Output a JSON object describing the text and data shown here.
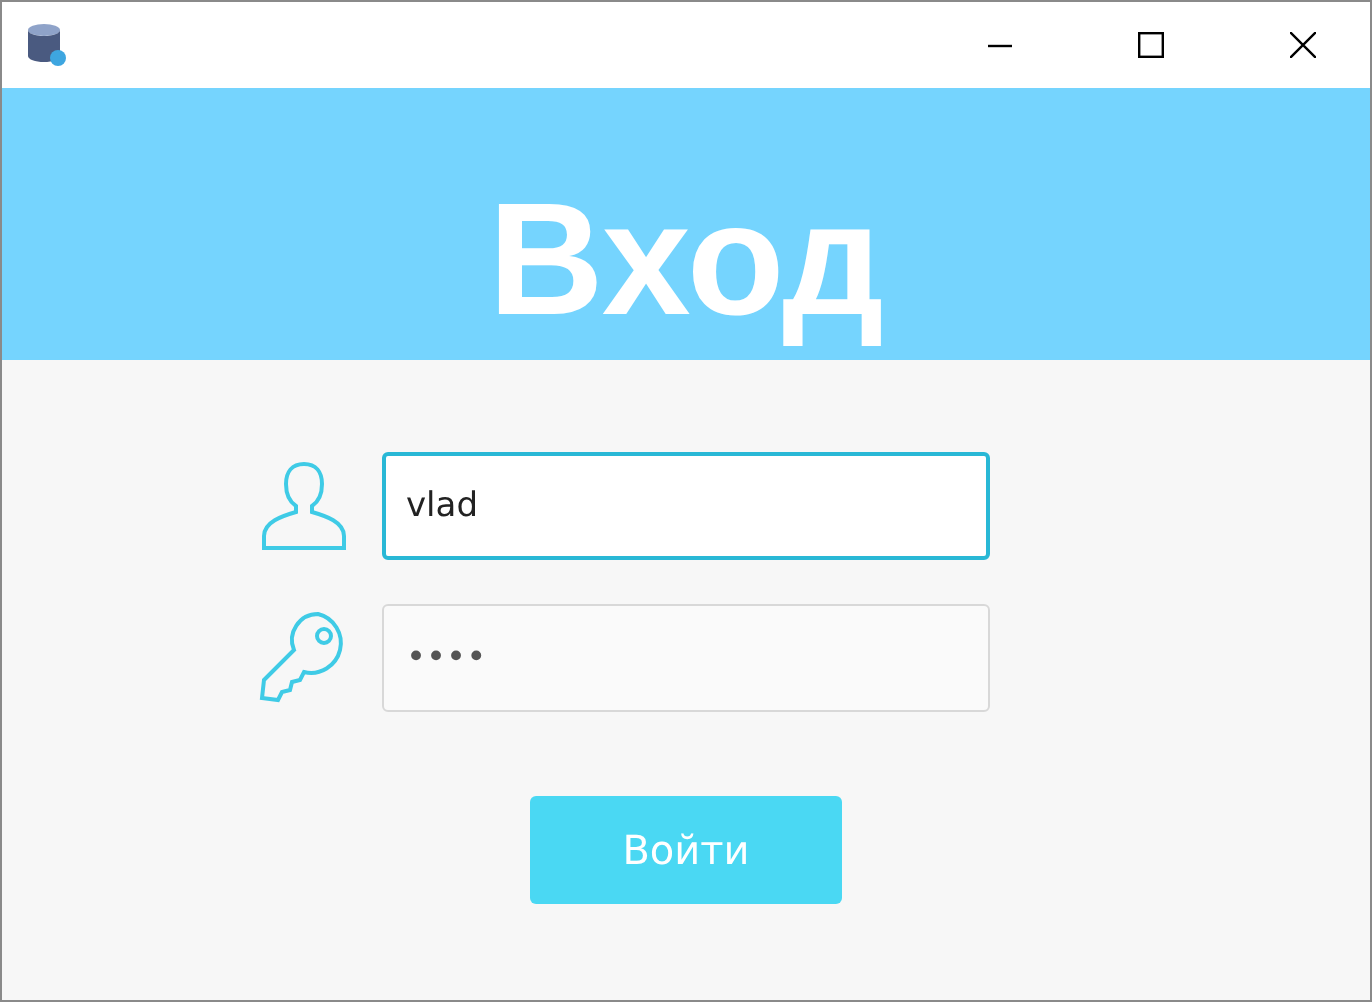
{
  "heading": "Вход",
  "fields": [
    {
      "kind": "login",
      "value": "vlad",
      "focused": true
    },
    {
      "kind": "password",
      "value": "••••",
      "focused": false
    }
  ],
  "button": "Войти"
}
